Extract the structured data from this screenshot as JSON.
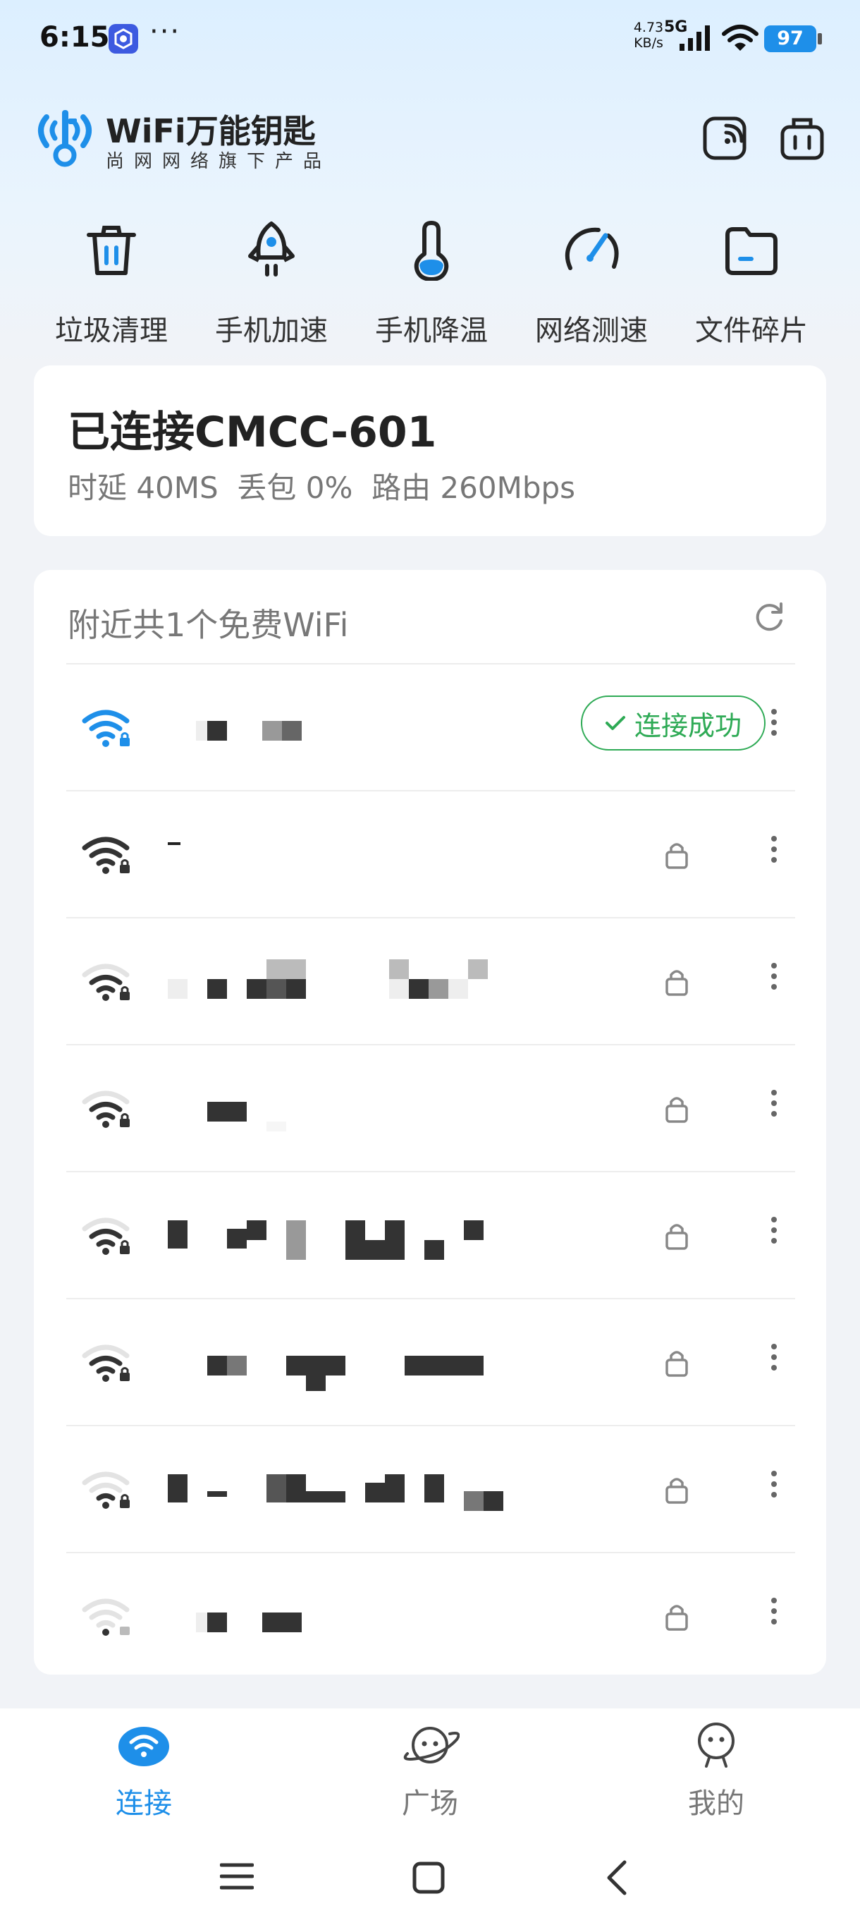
{
  "status_bar": {
    "time": "6:15",
    "more": "···",
    "net_speed_value": "4.73",
    "net_speed_unit": "KB/s",
    "net_type": "5G",
    "battery": "97"
  },
  "header": {
    "brand": "WiFi万能钥匙",
    "subtitle": "尚网网络旗下产品"
  },
  "tools": [
    {
      "label": "垃圾清理",
      "icon": "trash-icon"
    },
    {
      "label": "手机加速",
      "icon": "rocket-icon"
    },
    {
      "label": "手机降温",
      "icon": "thermometer-icon"
    },
    {
      "label": "网络测速",
      "icon": "speedometer-icon"
    },
    {
      "label": "文件碎片",
      "icon": "folder-icon"
    }
  ],
  "connection": {
    "title": "已连接CMCC-601",
    "stats": "时延 40MS  丢包 0%  路由 260Mbps"
  },
  "nearby": {
    "header": "附近共1个免费WiFi",
    "connected_label": "连接成功"
  },
  "nav": {
    "items": [
      {
        "label": "连接",
        "active": true
      },
      {
        "label": "广场",
        "active": false
      },
      {
        "label": "我的",
        "active": false
      }
    ]
  },
  "colors": {
    "accent_blue": "#1e8fe9",
    "success_green": "#2eaa55"
  }
}
